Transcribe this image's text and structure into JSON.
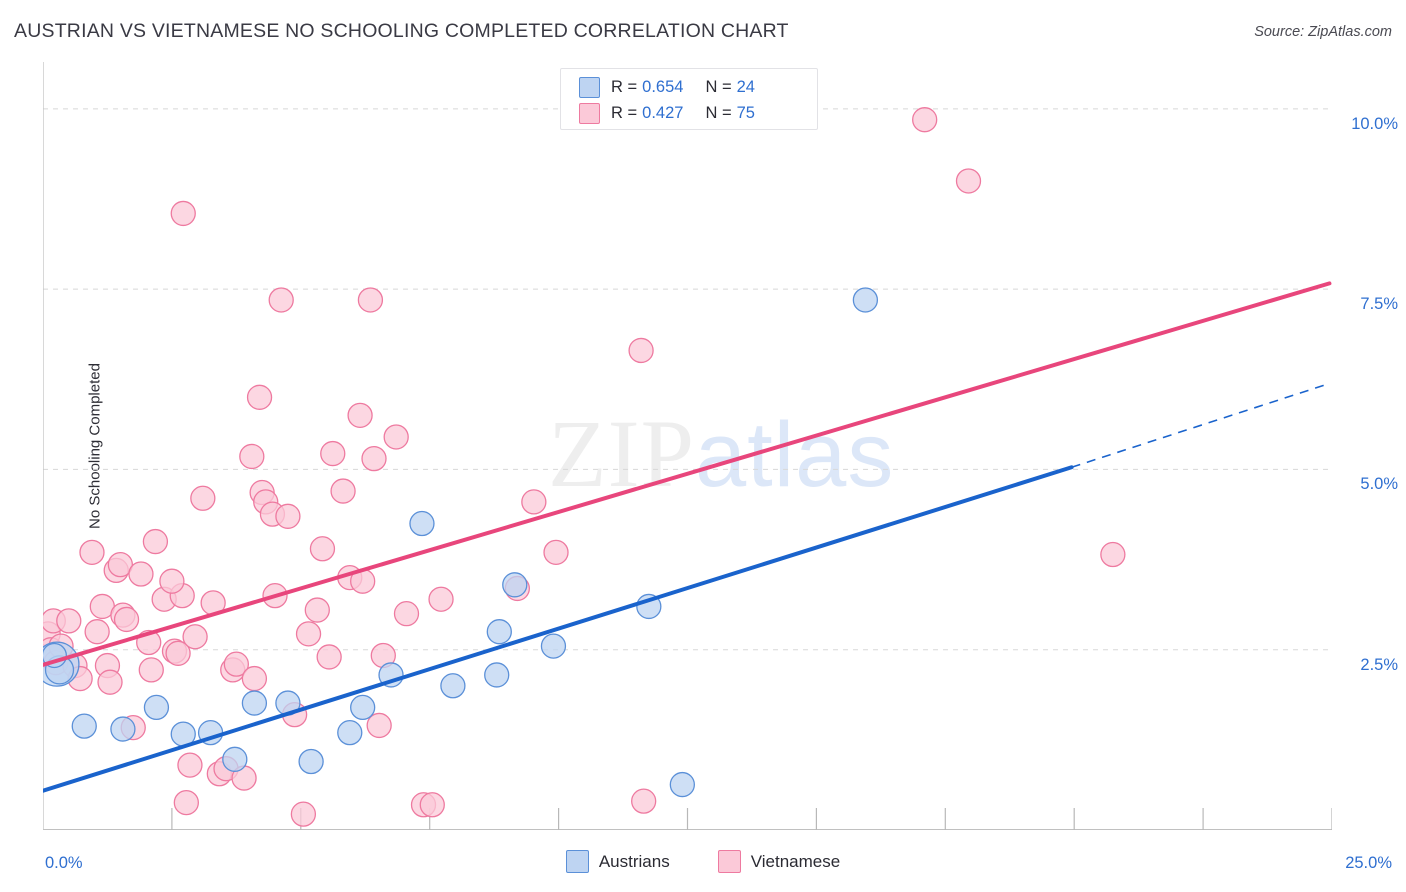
{
  "header": {
    "title": "AUSTRIAN VS VIETNAMESE NO SCHOOLING COMPLETED CORRELATION CHART",
    "source": "Source: ZipAtlas.com"
  },
  "watermark": {
    "zip": "ZIP",
    "atlas": "atlas"
  },
  "stats": {
    "rows": [
      {
        "color": "#bed4f2",
        "r_label": "R =",
        "r_value": "0.654",
        "n_label": "N =",
        "n_value": "24"
      },
      {
        "color": "#fbc9d8",
        "r_label": "R =",
        "r_value": "0.427",
        "n_label": "N =",
        "n_value": "75"
      }
    ]
  },
  "legend": {
    "items": [
      {
        "label": "Austrians",
        "color": "#bed4f2",
        "border": "#5b90d8"
      },
      {
        "label": "Vietnamese",
        "color": "#fbc9d8",
        "border": "#ee7aa0"
      }
    ]
  },
  "chart_data": {
    "type": "scatter",
    "title": "AUSTRIAN VS VIETNAMESE NO SCHOOLING COMPLETED CORRELATION CHART",
    "xlabel": "",
    "ylabel": "No Schooling Completed",
    "xlim": [
      0.0,
      25.0
    ],
    "ylim": [
      0.0,
      10.65
    ],
    "x_unit": "%",
    "y_unit": "%",
    "grid": true,
    "x_ticks": [
      {
        "value": 0.0,
        "label": "0.0%"
      },
      {
        "value": 25.0,
        "label": "25.0%"
      }
    ],
    "x_tick_marks": [
      2.5,
      5.0,
      7.5,
      10.0,
      12.5,
      15.0,
      17.5,
      20.0,
      22.5,
      25.0
    ],
    "y_ticks": [
      {
        "value": 2.5,
        "label": "2.5%"
      },
      {
        "value": 5.0,
        "label": "5.0%"
      },
      {
        "value": 7.5,
        "label": "7.5%"
      },
      {
        "value": 10.0,
        "label": "10.0%"
      }
    ],
    "legend_position": "bottom",
    "series": [
      {
        "name": "Austrians",
        "color": "#bed4f2",
        "border": "#5b90d8",
        "r": 0.654,
        "n": 24,
        "trendline": {
          "solid": {
            "x0": 0.0,
            "y0": 0.545,
            "x1": 19.95,
            "y1": 5.03
          },
          "dashed": {
            "x0": 19.95,
            "y0": 5.03,
            "x1": 24.9,
            "y1": 6.18
          }
        },
        "points": [
          {
            "x": 0.27,
            "y": 2.3,
            "r": 22
          },
          {
            "x": 0.32,
            "y": 2.22,
            "r": 14
          },
          {
            "x": 0.8,
            "y": 1.44,
            "r": 12
          },
          {
            "x": 1.55,
            "y": 1.4,
            "r": 12
          },
          {
            "x": 2.2,
            "y": 1.7,
            "r": 12
          },
          {
            "x": 2.72,
            "y": 1.33,
            "r": 12
          },
          {
            "x": 3.25,
            "y": 1.35,
            "r": 12
          },
          {
            "x": 3.72,
            "y": 0.98,
            "r": 12
          },
          {
            "x": 4.1,
            "y": 1.76,
            "r": 12
          },
          {
            "x": 4.75,
            "y": 1.76,
            "r": 12
          },
          {
            "x": 5.2,
            "y": 0.95,
            "r": 12
          },
          {
            "x": 5.95,
            "y": 1.35,
            "r": 12
          },
          {
            "x": 6.2,
            "y": 1.7,
            "r": 12
          },
          {
            "x": 6.75,
            "y": 2.15,
            "r": 12
          },
          {
            "x": 7.35,
            "y": 4.25,
            "r": 12
          },
          {
            "x": 7.95,
            "y": 2.0,
            "r": 12
          },
          {
            "x": 8.8,
            "y": 2.15,
            "r": 12
          },
          {
            "x": 8.85,
            "y": 2.75,
            "r": 12
          },
          {
            "x": 9.15,
            "y": 3.4,
            "r": 12
          },
          {
            "x": 9.9,
            "y": 2.55,
            "r": 12
          },
          {
            "x": 11.75,
            "y": 3.1,
            "r": 12
          },
          {
            "x": 12.4,
            "y": 0.63,
            "r": 12
          },
          {
            "x": 15.95,
            "y": 7.35,
            "r": 12
          },
          {
            "x": 0.22,
            "y": 2.42,
            "r": 12
          }
        ]
      },
      {
        "name": "Vietnamese",
        "color": "#fbc9d8",
        "border": "#ee7aa0",
        "r": 0.427,
        "n": 75,
        "trendline": {
          "solid": {
            "x0": 0.0,
            "y0": 2.29,
            "x1": 24.95,
            "y1": 7.58
          }
        },
        "points": [
          {
            "x": 0.1,
            "y": 2.72,
            "r": 12
          },
          {
            "x": 0.15,
            "y": 2.5,
            "r": 12
          },
          {
            "x": 0.2,
            "y": 2.9,
            "r": 12
          },
          {
            "x": 0.25,
            "y": 2.32,
            "r": 12
          },
          {
            "x": 0.35,
            "y": 2.55,
            "r": 12
          },
          {
            "x": 0.5,
            "y": 2.9,
            "r": 12
          },
          {
            "x": 0.62,
            "y": 2.28,
            "r": 12
          },
          {
            "x": 0.72,
            "y": 2.1,
            "r": 12
          },
          {
            "x": 0.95,
            "y": 3.85,
            "r": 12
          },
          {
            "x": 1.05,
            "y": 2.75,
            "r": 12
          },
          {
            "x": 1.15,
            "y": 3.1,
            "r": 12
          },
          {
            "x": 1.25,
            "y": 2.28,
            "r": 12
          },
          {
            "x": 1.3,
            "y": 2.05,
            "r": 12
          },
          {
            "x": 1.42,
            "y": 3.6,
            "r": 12
          },
          {
            "x": 1.5,
            "y": 3.68,
            "r": 12
          },
          {
            "x": 1.55,
            "y": 2.98,
            "r": 12
          },
          {
            "x": 1.62,
            "y": 2.92,
            "r": 12
          },
          {
            "x": 1.75,
            "y": 1.42,
            "r": 12
          },
          {
            "x": 1.9,
            "y": 3.55,
            "r": 12
          },
          {
            "x": 2.05,
            "y": 2.6,
            "r": 12
          },
          {
            "x": 2.1,
            "y": 2.22,
            "r": 12
          },
          {
            "x": 2.18,
            "y": 4.0,
            "r": 12
          },
          {
            "x": 2.35,
            "y": 3.2,
            "r": 12
          },
          {
            "x": 2.55,
            "y": 2.48,
            "r": 12
          },
          {
            "x": 2.62,
            "y": 2.45,
            "r": 12
          },
          {
            "x": 2.7,
            "y": 3.25,
            "r": 12
          },
          {
            "x": 2.72,
            "y": 8.55,
            "r": 12
          },
          {
            "x": 2.78,
            "y": 0.38,
            "r": 12
          },
          {
            "x": 2.85,
            "y": 0.9,
            "r": 12
          },
          {
            "x": 2.95,
            "y": 2.68,
            "r": 12
          },
          {
            "x": 3.1,
            "y": 4.6,
            "r": 12
          },
          {
            "x": 3.3,
            "y": 3.15,
            "r": 12
          },
          {
            "x": 3.42,
            "y": 0.78,
            "r": 12
          },
          {
            "x": 3.55,
            "y": 0.85,
            "r": 12
          },
          {
            "x": 3.68,
            "y": 2.22,
            "r": 12
          },
          {
            "x": 3.75,
            "y": 2.3,
            "r": 12
          },
          {
            "x": 3.9,
            "y": 0.72,
            "r": 12
          },
          {
            "x": 4.05,
            "y": 5.18,
            "r": 12
          },
          {
            "x": 4.1,
            "y": 2.1,
            "r": 12
          },
          {
            "x": 4.2,
            "y": 6.0,
            "r": 12
          },
          {
            "x": 4.25,
            "y": 4.68,
            "r": 12
          },
          {
            "x": 4.32,
            "y": 4.55,
            "r": 12
          },
          {
            "x": 4.45,
            "y": 4.38,
            "r": 12
          },
          {
            "x": 4.5,
            "y": 3.25,
            "r": 12
          },
          {
            "x": 4.62,
            "y": 7.35,
            "r": 12
          },
          {
            "x": 4.75,
            "y": 4.35,
            "r": 12
          },
          {
            "x": 4.88,
            "y": 1.6,
            "r": 12
          },
          {
            "x": 5.05,
            "y": 0.22,
            "r": 12
          },
          {
            "x": 5.15,
            "y": 2.72,
            "r": 12
          },
          {
            "x": 5.32,
            "y": 3.05,
            "r": 12
          },
          {
            "x": 5.42,
            "y": 3.9,
            "r": 12
          },
          {
            "x": 5.55,
            "y": 2.4,
            "r": 12
          },
          {
            "x": 5.62,
            "y": 5.22,
            "r": 12
          },
          {
            "x": 5.82,
            "y": 4.7,
            "r": 12
          },
          {
            "x": 5.95,
            "y": 3.5,
            "r": 12
          },
          {
            "x": 6.15,
            "y": 5.75,
            "r": 12
          },
          {
            "x": 6.2,
            "y": 3.45,
            "r": 12
          },
          {
            "x": 6.35,
            "y": 7.35,
            "r": 12
          },
          {
            "x": 6.42,
            "y": 5.15,
            "r": 12
          },
          {
            "x": 6.52,
            "y": 1.45,
            "r": 12
          },
          {
            "x": 6.6,
            "y": 2.42,
            "r": 12
          },
          {
            "x": 6.85,
            "y": 5.45,
            "r": 12
          },
          {
            "x": 7.05,
            "y": 3.0,
            "r": 12
          },
          {
            "x": 7.38,
            "y": 0.35,
            "r": 12
          },
          {
            "x": 7.55,
            "y": 0.35,
            "r": 12
          },
          {
            "x": 7.72,
            "y": 3.2,
            "r": 12
          },
          {
            "x": 9.2,
            "y": 3.35,
            "r": 12
          },
          {
            "x": 9.52,
            "y": 4.55,
            "r": 12
          },
          {
            "x": 9.95,
            "y": 3.85,
            "r": 12
          },
          {
            "x": 11.6,
            "y": 6.65,
            "r": 12
          },
          {
            "x": 11.65,
            "y": 0.4,
            "r": 12
          },
          {
            "x": 17.1,
            "y": 9.85,
            "r": 12
          },
          {
            "x": 17.95,
            "y": 9.0,
            "r": 12
          },
          {
            "x": 20.75,
            "y": 3.82,
            "r": 12
          },
          {
            "x": 2.5,
            "y": 3.45,
            "r": 12
          }
        ]
      }
    ]
  }
}
